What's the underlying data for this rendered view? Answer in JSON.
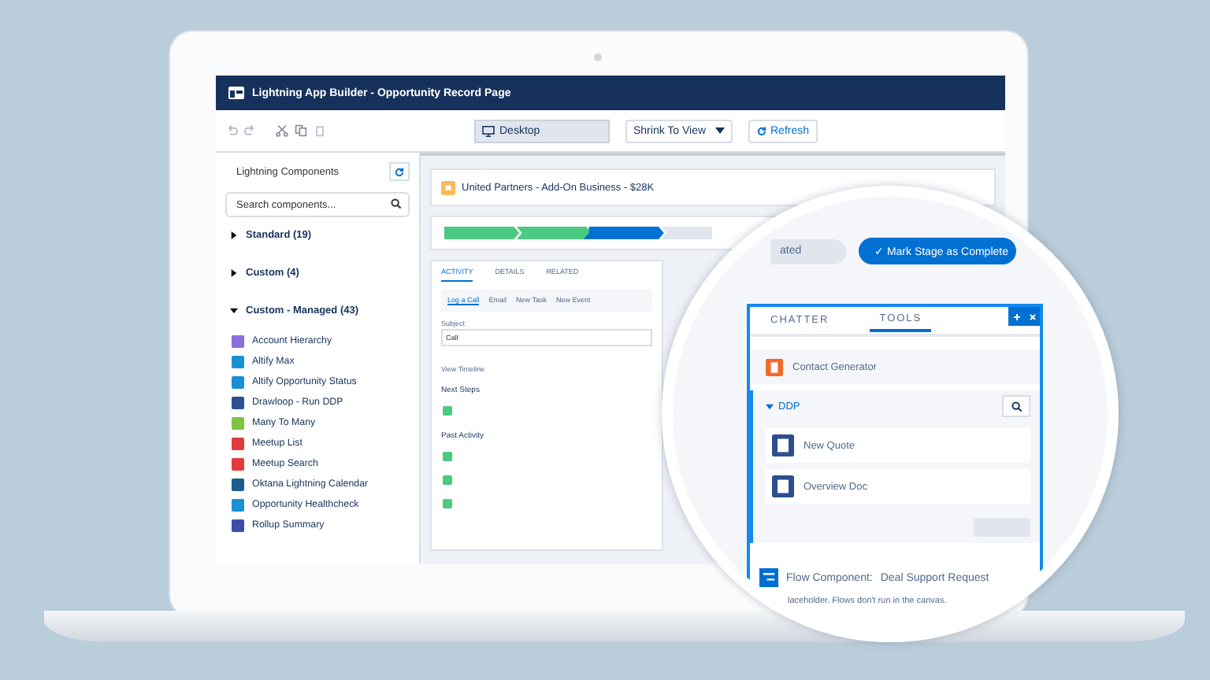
{
  "window": {
    "title": "Lightning App Builder - Opportunity Record Page"
  },
  "toolbar": {
    "device": "Desktop",
    "zoom": "Shrink To View",
    "refresh": "Refresh"
  },
  "sidebar": {
    "title": "Lightning Components",
    "search": {
      "placeholder": "Search components..."
    },
    "groups": [
      {
        "label": "Standard (19)",
        "expanded": false
      },
      {
        "label": "Custom (4)",
        "expanded": false
      },
      {
        "label": "Custom - Managed (43)",
        "expanded": true,
        "children": [
          {
            "label": "Account Hierarchy",
            "color": "#8a6fdc"
          },
          {
            "label": "Altify Max",
            "color": "#1b8fd6"
          },
          {
            "label": "Altify Opportunity Status",
            "color": "#1b8fd6"
          },
          {
            "label": "Drawloop - Run DDP",
            "color": "#2d4f8f"
          },
          {
            "label": "Many To Many",
            "color": "#7dc43f"
          },
          {
            "label": "Meetup List",
            "color": "#e23b3b"
          },
          {
            "label": "Meetup Search",
            "color": "#e23b3b"
          },
          {
            "label": "Oktana Lightning Calendar",
            "color": "#1d5d8f"
          },
          {
            "label": "Opportunity Healthcheck",
            "color": "#1b8fd6"
          },
          {
            "label": "Rollup Summary",
            "color": "#3b4fa8"
          }
        ]
      }
    ]
  },
  "record": {
    "title": "United Partners - Add-On Business - $28K",
    "tabs": [
      {
        "label": "ACTIVITY",
        "selected": true
      },
      {
        "label": "DETAILS",
        "selected": false
      },
      {
        "label": "RELATED",
        "selected": false
      }
    ],
    "actions": [
      {
        "label": "Log a Call",
        "selected": true
      },
      {
        "label": "Email",
        "selected": false
      },
      {
        "label": "New Task",
        "selected": false
      },
      {
        "label": "New Event",
        "selected": false
      }
    ],
    "subject_label": "Subject",
    "subject_value": "Call",
    "timeline": "View Timeline",
    "next_steps": "Next Steps",
    "past_activity": "Past Activity"
  },
  "magnifier": {
    "stage": "ated",
    "complete": "✓ Mark Stage as Complete",
    "panel_tabs": [
      {
        "label": "CHATTER",
        "selected": false
      },
      {
        "label": "TOOLS",
        "selected": true
      }
    ],
    "contact": "Contact Generator",
    "ddp": {
      "label": "DDP",
      "expanded": true,
      "docs": [
        "New Quote",
        "Overview Doc"
      ]
    },
    "flow": {
      "label": "Flow Component:",
      "name": "Deal Support Request",
      "note": "laceholder. Flows don't run in the canvas."
    }
  }
}
